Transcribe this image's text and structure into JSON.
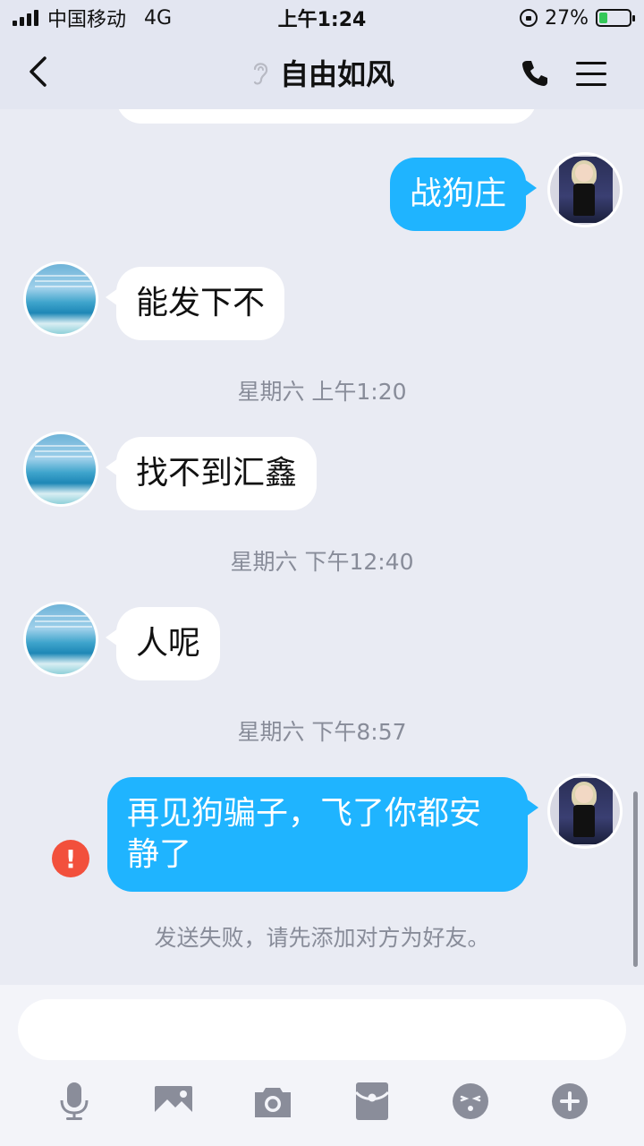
{
  "status_bar": {
    "carrier": "中国移动",
    "network": "4G",
    "time": "上午1:24",
    "battery_percent": "27%",
    "battery_level": 0.27,
    "charging": true
  },
  "header": {
    "title": "自由如风",
    "back_icon": "back-chevron-icon",
    "ear_icon": "ear-icon",
    "call_icon": "phone-icon",
    "menu_icon": "hamburger-menu-icon"
  },
  "messages": [
    {
      "id": "m1",
      "side": "out",
      "text": "战狗庄"
    },
    {
      "id": "m2",
      "side": "in",
      "text": "能发下不"
    },
    {
      "id": "t1",
      "type": "timestamp",
      "text": "星期六 上午1:20"
    },
    {
      "id": "m3",
      "side": "in",
      "text": "找不到汇鑫"
    },
    {
      "id": "t2",
      "type": "timestamp",
      "text": "星期六 下午12:40"
    },
    {
      "id": "m4",
      "side": "in",
      "text": "人呢"
    },
    {
      "id": "t3",
      "type": "timestamp",
      "text": "星期六 下午8:57"
    },
    {
      "id": "m5",
      "side": "out",
      "text": "再见狗骗子，飞了你都安静了",
      "failed": true
    }
  ],
  "failure_notice": "发送失败，请先添加对方为好友。",
  "input": {
    "value": "",
    "placeholder": ""
  },
  "toolbar": [
    {
      "icon": "microphone-icon"
    },
    {
      "icon": "image-icon"
    },
    {
      "icon": "camera-icon"
    },
    {
      "icon": "red-packet-icon"
    },
    {
      "icon": "emoji-icon"
    },
    {
      "icon": "plus-icon"
    }
  ],
  "colors": {
    "accent_bubble": "#1fb4ff",
    "error": "#f2503c",
    "background": "#e9ebf3"
  }
}
